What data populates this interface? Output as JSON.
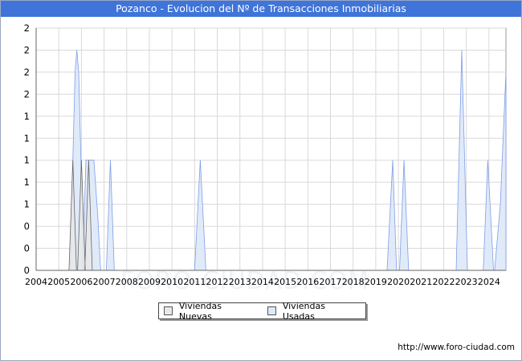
{
  "chart_data": {
    "type": "area",
    "title": "Pozanco - Evolucion del Nº de Transacciones Inmobiliarias",
    "y_tick_labels": [
      "0",
      "0",
      "0",
      "1",
      "1",
      "1",
      "1",
      "1",
      "2",
      "2",
      "2",
      "2"
    ],
    "ylim": [
      0,
      2.2
    ],
    "xlim": [
      2004,
      2024.75
    ],
    "x_tick_labels": [
      "2004",
      "2005",
      "2006",
      "2007",
      "2008",
      "2009",
      "2010",
      "2011",
      "2012",
      "2013",
      "2014",
      "2015",
      "2016",
      "2017",
      "2018",
      "2019",
      "2020",
      "2021",
      "2022",
      "2023",
      "2024"
    ],
    "grid": true,
    "legend_position": "bottom",
    "series": [
      {
        "name": "Viviendas Nuevas",
        "color": "#e8e8e8",
        "stroke": "#666666",
        "points": [
          [
            2005.45,
            0
          ],
          [
            2005.62,
            1
          ],
          [
            2005.78,
            0
          ],
          [
            2005.83,
            0
          ],
          [
            2006.0,
            1
          ],
          [
            2006.17,
            0
          ],
          [
            2006.15,
            0
          ],
          [
            2006.32,
            1
          ],
          [
            2006.48,
            0
          ]
        ]
      },
      {
        "name": "Viviendas Usadas",
        "color": "#dde8f8",
        "stroke": "#7f9ee6",
        "points": [
          [
            2005.5,
            0
          ],
          [
            2005.62,
            1
          ],
          [
            2005.72,
            1.8
          ],
          [
            2005.8,
            2
          ],
          [
            2005.88,
            1.8
          ],
          [
            2005.98,
            1
          ],
          [
            2006.1,
            0
          ],
          [
            2006.05,
            0
          ],
          [
            2006.2,
            1
          ],
          [
            2006.3,
            1
          ],
          [
            2006.42,
            1
          ],
          [
            2006.55,
            1
          ],
          [
            2006.72,
            0.5
          ],
          [
            2006.85,
            0
          ],
          [
            2007.1,
            0
          ],
          [
            2007.28,
            1
          ],
          [
            2007.45,
            0
          ],
          [
            2011.0,
            0
          ],
          [
            2011.25,
            1
          ],
          [
            2011.5,
            0
          ],
          [
            2019.5,
            0
          ],
          [
            2019.75,
            1
          ],
          [
            2019.92,
            0
          ],
          [
            2020.05,
            0
          ],
          [
            2020.25,
            1
          ],
          [
            2020.45,
            0
          ],
          [
            2022.55,
            0
          ],
          [
            2022.8,
            2
          ],
          [
            2023.05,
            0
          ],
          [
            2023.75,
            0
          ],
          [
            2023.95,
            1
          ],
          [
            2024.2,
            0
          ],
          [
            2024.25,
            0
          ],
          [
            2024.5,
            0.6
          ],
          [
            2024.75,
            1.8
          ]
        ]
      }
    ]
  },
  "footer": {
    "url": "http://www.foro-ciudad.com"
  }
}
